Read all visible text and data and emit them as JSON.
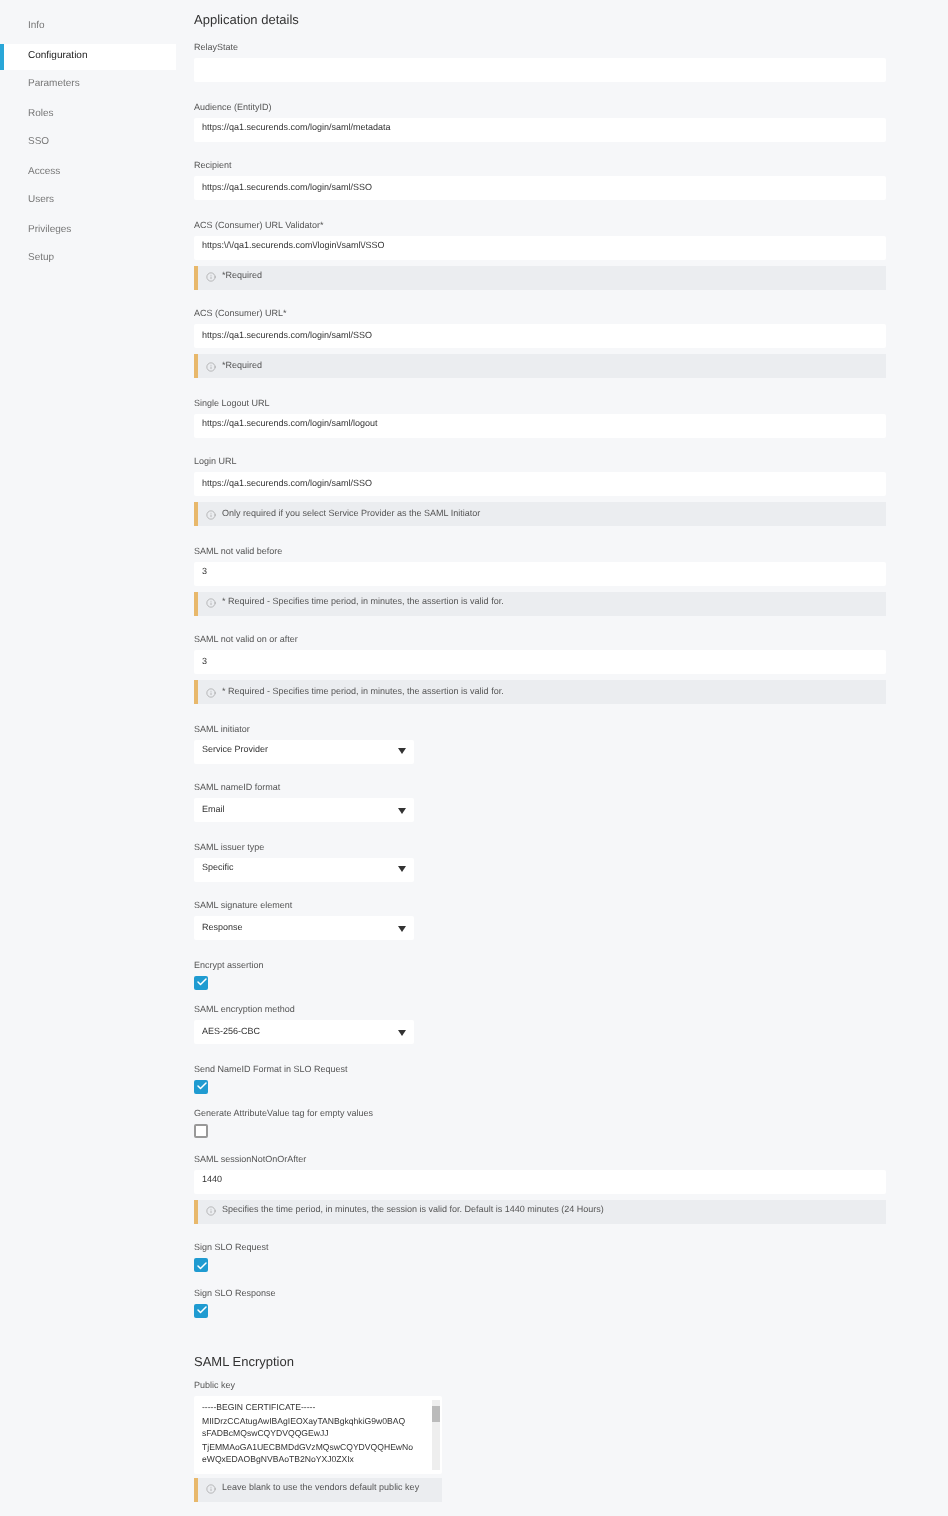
{
  "sidebar": {
    "items": [
      {
        "label": "Info",
        "selected": false
      },
      {
        "label": "Configuration",
        "selected": true
      },
      {
        "label": "Parameters",
        "selected": false
      },
      {
        "label": "Roles",
        "selected": false
      },
      {
        "label": "SSO",
        "selected": false
      },
      {
        "label": "Access",
        "selected": false
      },
      {
        "label": "Users",
        "selected": false
      },
      {
        "label": "Privileges",
        "selected": false
      },
      {
        "label": "Setup",
        "selected": false
      }
    ]
  },
  "application_details": {
    "title": "Application details",
    "fields": [
      {
        "kind": "text",
        "label": "RelayState"
      },
      {
        "kind": "text",
        "label": "Audience (EntityID)",
        "value": "https://qa1.securends.com/login/saml/metadata"
      },
      {
        "kind": "text",
        "label": "Recipient",
        "value": "https://qa1.securends.com/login/saml/SSO"
      },
      {
        "kind": "text",
        "label": "ACS (Consumer) URL Validator*",
        "value": "https:\\/\\/qa1.securends.com\\/login\\/saml\\/SSO",
        "note": "*Required"
      },
      {
        "kind": "text",
        "label": "ACS (Consumer) URL*",
        "value": "https://qa1.securends.com/login/saml/SSO",
        "note": "*Required"
      },
      {
        "kind": "text",
        "label": "Single Logout URL",
        "value": "https://qa1.securends.com/login/saml/logout"
      },
      {
        "kind": "text",
        "label": "Login URL",
        "value": "https://qa1.securends.com/login/saml/SSO",
        "note": "Only required if you select Service Provider as the SAML Initiator"
      },
      {
        "kind": "text",
        "label": "SAML not valid before",
        "value": "3",
        "note": "* Required - Specifies time period, in minutes, the assertion is valid for."
      },
      {
        "kind": "text",
        "label": "SAML not valid on or after",
        "value": "3",
        "note": "* Required - Specifies time period, in minutes, the assertion is valid for."
      },
      {
        "kind": "select",
        "label": "SAML initiator",
        "value": "Service Provider"
      },
      {
        "kind": "select",
        "label": "SAML nameID format",
        "value": "Email"
      },
      {
        "kind": "select",
        "label": "SAML issuer type",
        "value": "Specific"
      },
      {
        "kind": "select",
        "label": "SAML signature element",
        "value": "Response"
      },
      {
        "kind": "checkbox",
        "label": "Encrypt assertion",
        "checked": true
      },
      {
        "kind": "select",
        "label": "SAML encryption method",
        "value": "AES-256-CBC"
      },
      {
        "kind": "checkbox",
        "label": "Send NameID Format in SLO Request",
        "checked": true
      },
      {
        "kind": "checkbox",
        "label": "Generate AttributeValue tag for empty values",
        "checked": false
      },
      {
        "kind": "text",
        "label": "SAML sessionNotOnOrAfter",
        "value": "1440",
        "note": "Specifies the time period, in minutes, the session is valid for. Default is 1440 minutes (24 Hours)"
      },
      {
        "kind": "checkbox",
        "label": "Sign SLO Request",
        "checked": true
      },
      {
        "kind": "checkbox",
        "label": "Sign SLO Response",
        "checked": true
      }
    ]
  },
  "saml_encryption": {
    "title": "SAML Encryption",
    "public_key": {
      "label": "Public key",
      "lines": [
        "-----BEGIN CERTIFICATE-----",
        "MIIDrzCCAtugAwIBAgIEOXayTANBgkqhkiG9w0BAQ",
        "sFADBcMQswCQYDVQQGEwJJ",
        "TjEMMAoGA1UECBMDdGVzMQswCQYDVQQHEwNo",
        "eWQxEDAOBgNVBAoTB2NoYXJ0ZXIx"
      ],
      "note": "Leave blank to use the vendors default public key"
    }
  }
}
